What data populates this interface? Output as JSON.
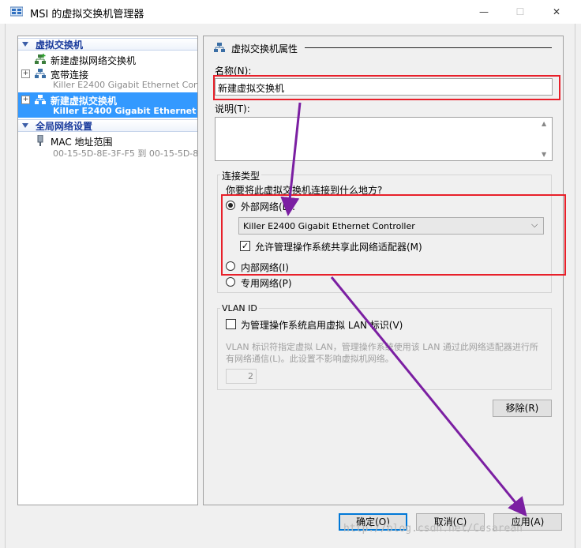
{
  "window": {
    "title": "MSI 的虚拟交换机管理器",
    "controls": {
      "minimize": "—",
      "maximize": "☐",
      "close": "✕"
    }
  },
  "tree": {
    "virtual_switches_header": "虚拟交换机",
    "items": [
      {
        "label": "新建虚拟网络交换机"
      },
      {
        "label": "宽带连接",
        "sub": "Killer E2400 Gigabit Ethernet Contr...",
        "expander": "+"
      },
      {
        "label": "新建虚拟交换机",
        "sub": "Killer E2400 Gigabit Ethernet C...",
        "expander": "+",
        "selected": true
      }
    ],
    "global_header": "全局网络设置",
    "mac": {
      "label": "MAC 地址范围",
      "sub": "00-15-5D-8E-3F-F5 到 00-15-5D-8..."
    }
  },
  "properties": {
    "header": "虚拟交换机属性",
    "name_label": "名称(N):",
    "name_value": "新建虚拟交换机",
    "notes_label": "说明(T):",
    "notes_value": "",
    "connection_type": {
      "title": "连接类型",
      "question": "你要将此虚拟交换机连接到什么地方?",
      "external_label": "外部网络(E):",
      "adapter_selected": "Killer E2400 Gigabit Ethernet Controller",
      "allow_mgmt_label": "允许管理操作系统共享此网络适配器(M)",
      "allow_mgmt_checked": true,
      "internal_label": "内部网络(I)",
      "private_label": "专用网络(P)",
      "selected": "external"
    },
    "vlan": {
      "title": "VLAN ID",
      "enable_label": "为管理操作系统启用虚拟 LAN 标识(V)",
      "enable_checked": false,
      "description": "VLAN 标识符指定虚拟 LAN，管理操作系统使用该 LAN 通过此网络适配器进行所有网络通信(L)。此设置不影响虚拟机网络。",
      "value": "2"
    },
    "remove_button": "移除(R)"
  },
  "footer": {
    "ok": "确定(O)",
    "cancel": "取消(C)",
    "apply": "应用(A)"
  },
  "watermark": "http://blog.csdn.net/Cesarean",
  "colors": {
    "selection": "#3399ff",
    "annotation_red": "#e8202a",
    "annotation_arrow": "#7b1fa2",
    "tree_header": "#1a3b9c"
  }
}
